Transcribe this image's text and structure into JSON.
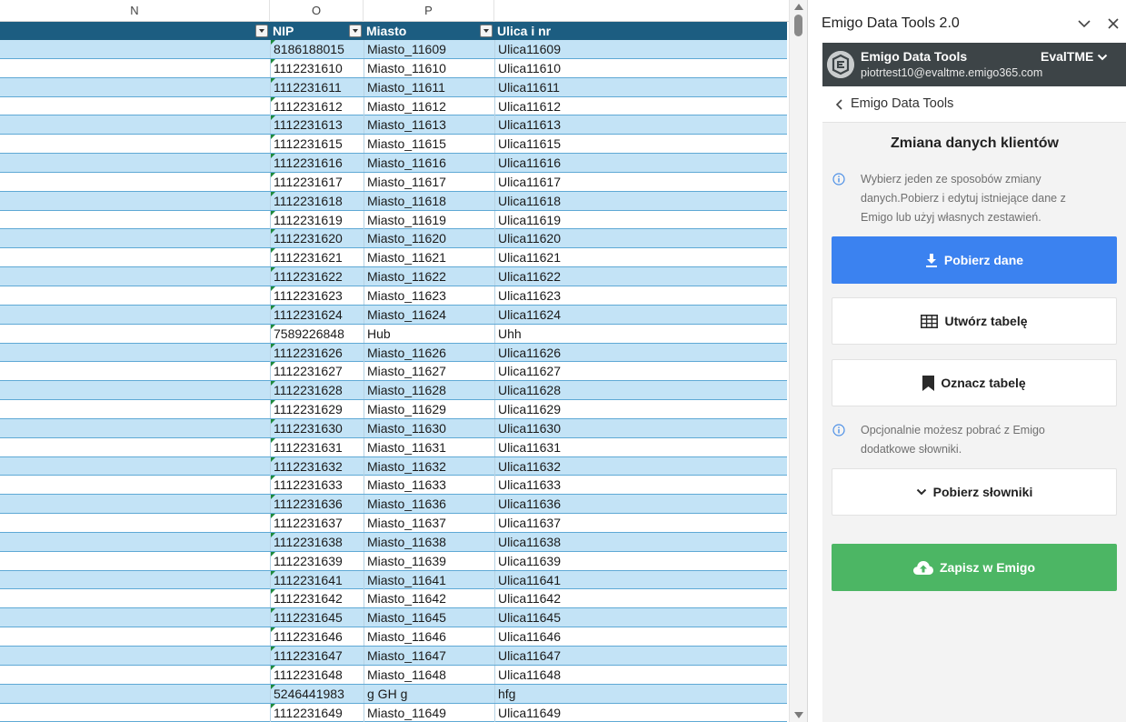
{
  "sheet": {
    "column_letters": [
      "N",
      "O",
      "P"
    ],
    "headers": {
      "nip": "NIP",
      "miasto": "Miasto",
      "ulica": "Ulica i nr"
    },
    "rows": [
      {
        "nip": "8186188015",
        "miasto": "Miasto_11609",
        "ulica": "Ulica11609"
      },
      {
        "nip": "1112231610",
        "miasto": "Miasto_11610",
        "ulica": "Ulica11610"
      },
      {
        "nip": "1112231611",
        "miasto": "Miasto_11611",
        "ulica": "Ulica11611"
      },
      {
        "nip": "1112231612",
        "miasto": "Miasto_11612",
        "ulica": "Ulica11612"
      },
      {
        "nip": "1112231613",
        "miasto": "Miasto_11613",
        "ulica": "Ulica11613"
      },
      {
        "nip": "1112231615",
        "miasto": "Miasto_11615",
        "ulica": "Ulica11615"
      },
      {
        "nip": "1112231616",
        "miasto": "Miasto_11616",
        "ulica": "Ulica11616"
      },
      {
        "nip": "1112231617",
        "miasto": "Miasto_11617",
        "ulica": "Ulica11617"
      },
      {
        "nip": "1112231618",
        "miasto": "Miasto_11618",
        "ulica": "Ulica11618"
      },
      {
        "nip": "1112231619",
        "miasto": "Miasto_11619",
        "ulica": "Ulica11619"
      },
      {
        "nip": "1112231620",
        "miasto": "Miasto_11620",
        "ulica": "Ulica11620"
      },
      {
        "nip": "1112231621",
        "miasto": "Miasto_11621",
        "ulica": "Ulica11621"
      },
      {
        "nip": "1112231622",
        "miasto": "Miasto_11622",
        "ulica": "Ulica11622"
      },
      {
        "nip": "1112231623",
        "miasto": "Miasto_11623",
        "ulica": "Ulica11623"
      },
      {
        "nip": "1112231624",
        "miasto": "Miasto_11624",
        "ulica": "Ulica11624"
      },
      {
        "nip": "7589226848",
        "miasto": "Hub",
        "ulica": "Uhh"
      },
      {
        "nip": "1112231626",
        "miasto": "Miasto_11626",
        "ulica": "Ulica11626"
      },
      {
        "nip": "1112231627",
        "miasto": "Miasto_11627",
        "ulica": "Ulica11627"
      },
      {
        "nip": "1112231628",
        "miasto": "Miasto_11628",
        "ulica": "Ulica11628"
      },
      {
        "nip": "1112231629",
        "miasto": "Miasto_11629",
        "ulica": "Ulica11629"
      },
      {
        "nip": "1112231630",
        "miasto": "Miasto_11630",
        "ulica": "Ulica11630"
      },
      {
        "nip": "1112231631",
        "miasto": "Miasto_11631",
        "ulica": "Ulica11631"
      },
      {
        "nip": "1112231632",
        "miasto": "Miasto_11632",
        "ulica": "Ulica11632"
      },
      {
        "nip": "1112231633",
        "miasto": "Miasto_11633",
        "ulica": "Ulica11633"
      },
      {
        "nip": "1112231636",
        "miasto": "Miasto_11636",
        "ulica": "Ulica11636"
      },
      {
        "nip": "1112231637",
        "miasto": "Miasto_11637",
        "ulica": "Ulica11637"
      },
      {
        "nip": "1112231638",
        "miasto": "Miasto_11638",
        "ulica": "Ulica11638"
      },
      {
        "nip": "1112231639",
        "miasto": "Miasto_11639",
        "ulica": "Ulica11639"
      },
      {
        "nip": "1112231641",
        "miasto": "Miasto_11641",
        "ulica": "Ulica11641"
      },
      {
        "nip": "1112231642",
        "miasto": "Miasto_11642",
        "ulica": "Ulica11642"
      },
      {
        "nip": "1112231645",
        "miasto": "Miasto_11645",
        "ulica": "Ulica11645"
      },
      {
        "nip": "1112231646",
        "miasto": "Miasto_11646",
        "ulica": "Ulica11646"
      },
      {
        "nip": "1112231647",
        "miasto": "Miasto_11647",
        "ulica": "Ulica11647"
      },
      {
        "nip": "1112231648",
        "miasto": "Miasto_11648",
        "ulica": "Ulica11648"
      },
      {
        "nip": "5246441983",
        "miasto": "g GH g",
        "ulica": "hfg"
      },
      {
        "nip": "1112231649",
        "miasto": "Miasto_11649",
        "ulica": "Ulica11649"
      }
    ]
  },
  "pane": {
    "title": "Emigo Data Tools 2.0",
    "account": {
      "app_name": "Emigo Data Tools",
      "email": "piotrtest10@evaltme.emigo365.com",
      "tenant": "EvalTME"
    },
    "back_label": "Emigo Data Tools",
    "main_title": "Zmiana danych klientów",
    "info_lines": [
      "Wybierz jeden ze sposobów zmiany",
      "danych.Pobierz i edytuj istniejące dane z",
      "Emigo lub użyj własnych zestawień."
    ],
    "optional_lines": [
      "Opcjonalnie możesz pobrać z Emigo",
      "dodatkowe słowniki."
    ],
    "buttons": {
      "download": "Pobierz dane",
      "create_table": "Utwórz tabelę",
      "mark_table": "Oznacz tabelę",
      "dictionaries": "Pobierz słowniki",
      "save": "Zapisz w Emigo"
    }
  },
  "colors": {
    "table_header": "#1c5d81",
    "band_row": "#c3e3f6",
    "primary_button": "#3b82f0",
    "save_button": "#4cb664",
    "account_bar": "#3d4447"
  }
}
